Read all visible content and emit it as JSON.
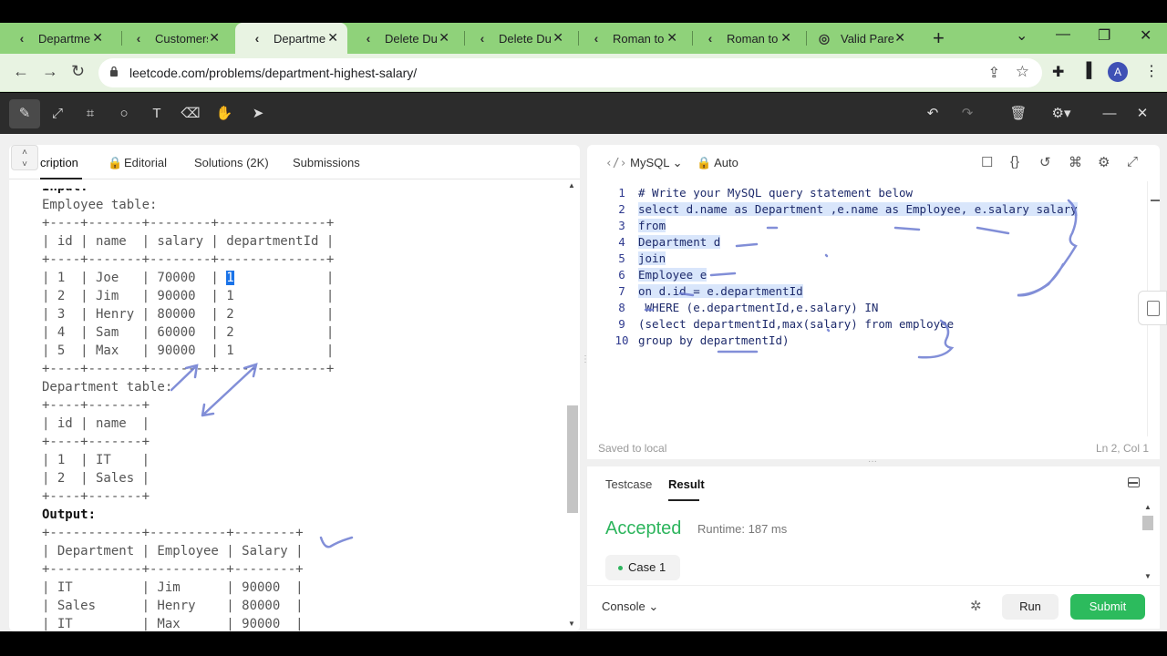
{
  "browser": {
    "tabs": [
      {
        "title": "Departmen",
        "icon": "leetcode-icon"
      },
      {
        "title": "Customers",
        "icon": "leetcode-icon"
      },
      {
        "title": "Departmen",
        "icon": "leetcode-icon",
        "active": true
      },
      {
        "title": "Delete Dup",
        "icon": "leetcode-icon"
      },
      {
        "title": "Delete Dup",
        "icon": "leetcode-icon"
      },
      {
        "title": "Roman to",
        "icon": "leetcode-icon"
      },
      {
        "title": "Roman to",
        "icon": "leetcode-icon"
      },
      {
        "title": "Valid Paren",
        "icon": "globe-icon"
      }
    ],
    "url": "leetcode.com/problems/department-highest-salary/",
    "avatar_letter": "A",
    "theme_color": "#8fd27a"
  },
  "left_panel": {
    "tabs": [
      "cription",
      "Editorial",
      "Solutions (2K)",
      "Submissions"
    ],
    "lines": [
      "Input:",
      "Employee table:",
      "+----+-------+--------+--------------+",
      "| id | name  | salary | departmentId |",
      "+----+-------+--------+--------------+",
      "| 1  | Joe   | 70000  | ",
      "| 2  | Jim   | 90000  | 1            |",
      "| 3  | Henry | 80000  | 2            |",
      "| 4  | Sam   | 60000  | 2            |",
      "| 5  | Max   | 90000  | 1            |",
      "+----+-------+--------+--------------+",
      "Department table:",
      "+----+-------+",
      "| id | name  |",
      "+----+-------+",
      "| 1  | IT    |",
      "| 2  | Sales |",
      "+----+-------+",
      "Output:",
      "+------------+----------+--------+",
      "| Department | Employee | Salary |",
      "+------------+----------+--------+",
      "| IT         | Jim      | 90000  |",
      "| Sales      | Henry    | 80000  |",
      "| IT         | Max      | 90000  |"
    ],
    "highlight_value": "1",
    "highlight_tail": "            |"
  },
  "editor": {
    "language": "MySQL",
    "mode": "Auto",
    "code_lines": [
      "# Write your MySQL query statement below",
      "select d.name as Department ,e.name as Employee, e.salary salary",
      "from",
      "Department d",
      "join",
      "Employee e",
      "on d.id = e.departmentId",
      " WHERE (e.departmentId,e.salary) IN",
      "(select departmentId,max(salary) from employee",
      "group by departmentId)"
    ],
    "line_numbers": [
      "1",
      "2",
      "3",
      "4",
      "5",
      "6",
      "7",
      "8",
      "9",
      "10"
    ],
    "saved_status": "Saved to local",
    "cursor_position": "Ln 2, Col 1"
  },
  "result": {
    "tabs": [
      "Testcase",
      "Result"
    ],
    "status": "Accepted",
    "runtime": "Runtime: 187 ms",
    "case_label": "Case 1",
    "status_color": "#2db55d"
  },
  "bottom": {
    "console_label": "Console",
    "run_label": "Run",
    "submit_label": "Submit",
    "submit_color": "#2cbb5d"
  }
}
